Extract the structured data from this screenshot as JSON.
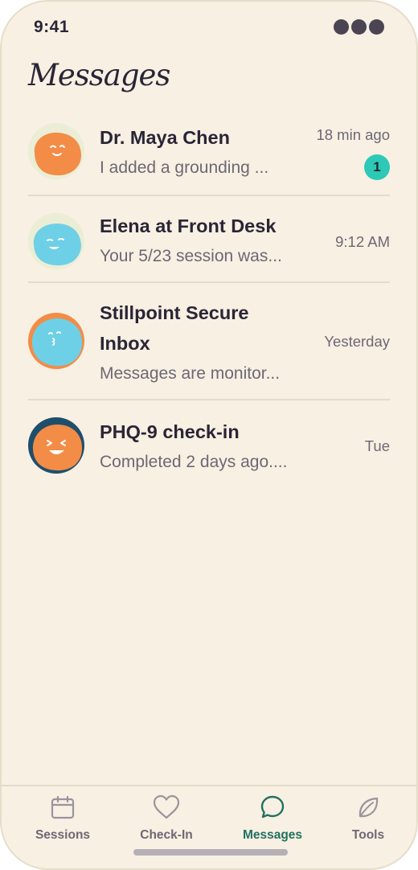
{
  "status_bar": {
    "time": "9:41"
  },
  "header": {
    "title": "Messages"
  },
  "conversations": [
    {
      "name": "Dr. Maya Chen",
      "preview": "I added a grounding ...",
      "time": "18 min ago",
      "unread": "1"
    },
    {
      "name": "Elena at Front Desk",
      "preview": "Your 5/23 session was...",
      "time": "9:12 AM"
    },
    {
      "name": "Stillpoint Secure Inbox",
      "preview": "Messages are monitor...",
      "time": "Yesterday"
    },
    {
      "name": "PHQ-9 check-in",
      "preview": "Completed 2 days ago....",
      "time": "Tue"
    }
  ],
  "tab_bar": {
    "items": [
      {
        "label": "Sessions",
        "icon": "calendar-icon",
        "active": false
      },
      {
        "label": "Check-In",
        "icon": "heart-icon",
        "active": false
      },
      {
        "label": "Messages",
        "icon": "chat-bubble-icon",
        "active": true
      },
      {
        "label": "Tools",
        "icon": "leaf-icon",
        "active": false
      }
    ]
  },
  "colors": {
    "background": "#f7f0e3",
    "accent": "#22715f",
    "badge": "#2ec9b6",
    "avatar_orange": "#f38c47",
    "avatar_blue": "#6ed0e6",
    "text_primary": "#2a2536",
    "text_secondary": "#6d6873"
  }
}
